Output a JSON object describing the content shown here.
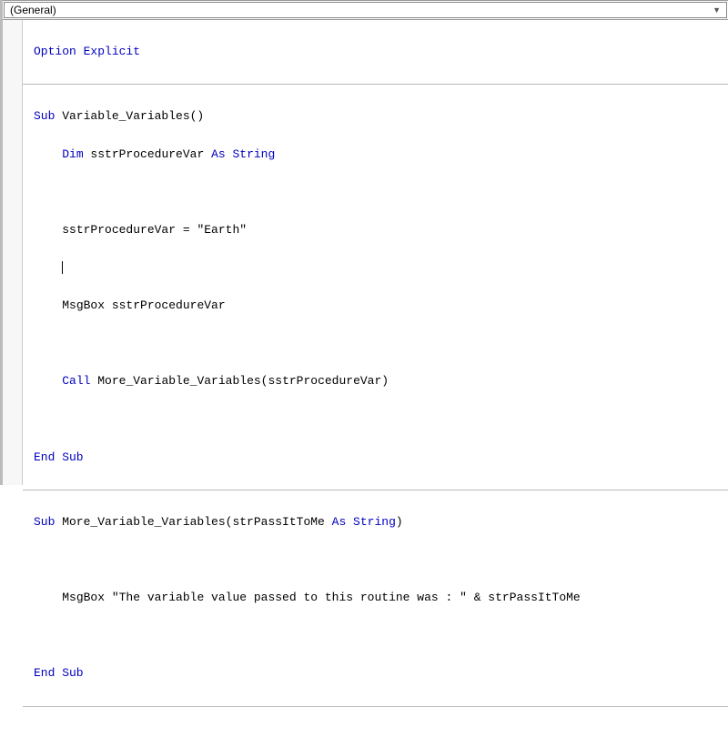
{
  "dropdown": {
    "scope_label": "(General)"
  },
  "code": {
    "option_explicit_kw": "Option Explicit",
    "sub1_kw_sub": "Sub",
    "sub1_name": " Variable_Variables()",
    "dim_kw": "Dim",
    "dim_rest": " sstrProcedureVar ",
    "as_string_kw": "As String",
    "assign": "sstrProcedureVar = ",
    "assign_val": "\"Earth\"",
    "msgbox1": "MsgBox sstrProcedureVar",
    "call_kw": "Call",
    "call_rest": " More_Variable_Variables(sstrProcedureVar)",
    "end_sub1": "End Sub",
    "sub2_kw_sub": "Sub",
    "sub2_name": " More_Variable_Variables(strPassItToMe ",
    "sub2_as_string": "As String",
    "sub2_close": ")",
    "msgbox2_pre": "MsgBox ",
    "msgbox2_str": "\"The variable value passed to this routine was : \"",
    "msgbox2_post": " & strPassItToMe",
    "end_sub2": "End Sub"
  }
}
